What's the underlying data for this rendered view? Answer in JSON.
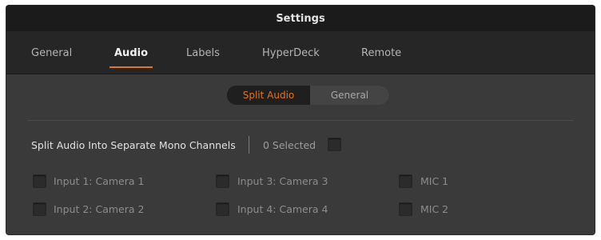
{
  "window": {
    "title": "Settings"
  },
  "tabs": [
    {
      "label": "General",
      "active": false
    },
    {
      "label": "Audio",
      "active": true
    },
    {
      "label": "Labels",
      "active": false
    },
    {
      "label": "HyperDeck",
      "active": false
    },
    {
      "label": "Remote",
      "active": false
    }
  ],
  "segmented": {
    "options": [
      {
        "label": "Split Audio",
        "selected": true
      },
      {
        "label": "General",
        "selected": false
      }
    ]
  },
  "split_audio": {
    "heading": "Split Audio Into Separate Mono Channels",
    "selected_count": "0 Selected",
    "select_all_checked": false,
    "inputs": [
      {
        "label": "Input 1: Camera 1",
        "checked": false
      },
      {
        "label": "Input 3: Camera 3",
        "checked": false
      },
      {
        "label": "MIC 1",
        "checked": false
      },
      {
        "label": "Input 2: Camera 2",
        "checked": false
      },
      {
        "label": "Input 4: Camera 4",
        "checked": false
      },
      {
        "label": "MIC 2",
        "checked": false
      }
    ]
  },
  "colors": {
    "accent": "#e5741a",
    "panel_bg": "#3a3a3a",
    "titlebar_bg": "#1b1b1b",
    "tabbar_bg": "#262626"
  }
}
